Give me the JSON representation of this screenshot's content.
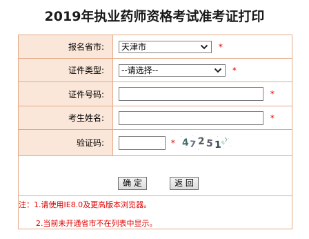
{
  "page_title": "2019年执业药师资格考试准考证打印",
  "form": {
    "province": {
      "label": "报名省市:",
      "selected": "天津市",
      "required_mark": "*"
    },
    "cert_type": {
      "label": "证件类型:",
      "selected": "--请选择--",
      "required_mark": "*"
    },
    "cert_number": {
      "label": "证件号码:",
      "value": "",
      "required_mark": "*"
    },
    "exam_name": {
      "label": "考生姓名:",
      "value": "",
      "required_mark": "*"
    },
    "captcha": {
      "label": "验证码:",
      "value": "",
      "required_mark": "*",
      "image_text": "47251"
    }
  },
  "buttons": {
    "confirm_label": "确 定",
    "back_label": "返 回"
  },
  "notes": {
    "line1": "注：1.请使用IE8.0及更高版本浏览器。",
    "line2": "2.当前未开通省市不在列表中显示。"
  },
  "colors": {
    "border": "#e2a986",
    "label_bg": "#fbe7d9",
    "required": "#e00000",
    "notes_text": "#e00000"
  },
  "icons": {
    "select_arrow": "chevron-down-icon"
  }
}
